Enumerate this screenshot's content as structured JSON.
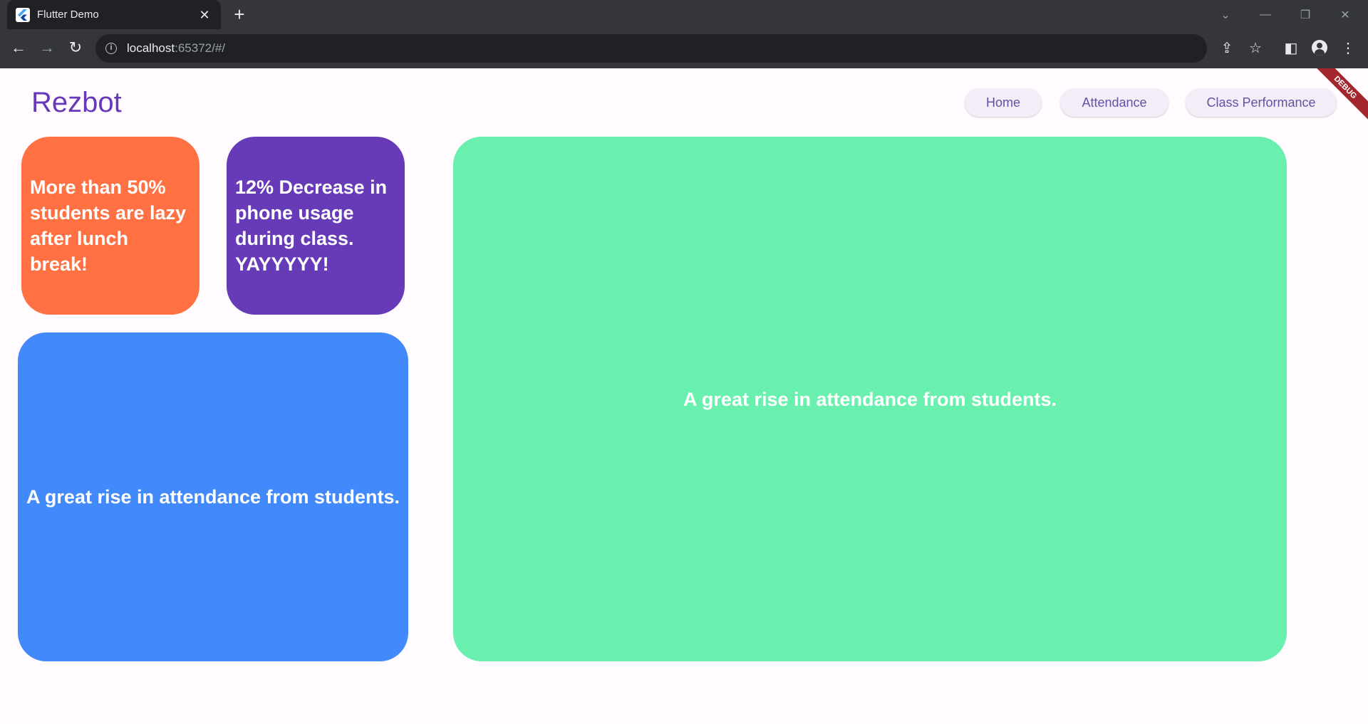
{
  "browser": {
    "tab_title": "Flutter Demo",
    "tab_close": "✕",
    "new_tab": "+",
    "url_host": "localhost",
    "url_path": ":65372/#/"
  },
  "app": {
    "brand": "Rezbot",
    "nav": [
      "Home",
      "Attendance",
      "Class Performance"
    ],
    "debug_banner": "DEBUG",
    "cards": {
      "orange": "More than 50% students are lazy after lunch break!",
      "purple": "12% Decrease in phone usage during class. YAYYYYY!",
      "blue": "A great rise in attendance from students.",
      "green": "A great rise in attendance from students."
    }
  },
  "colors": {
    "brand": "#6739b7",
    "orange": "#ff7043",
    "purple": "#673ab7",
    "blue": "#4289fc",
    "green": "#69f0ae"
  }
}
